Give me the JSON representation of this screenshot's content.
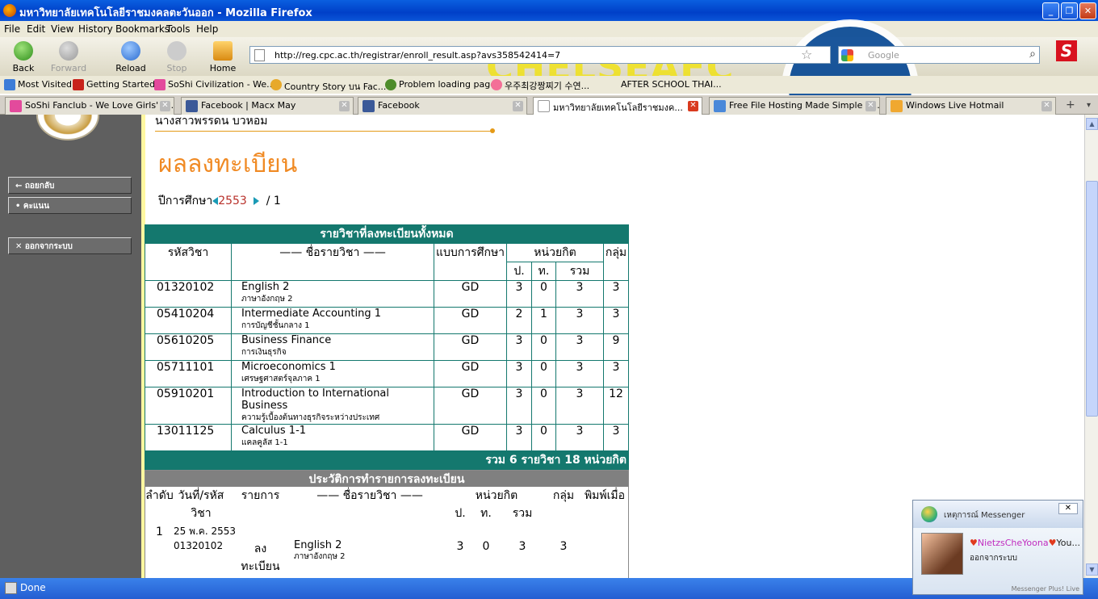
{
  "window": {
    "title": "มหาวิทยาลัยเทคโนโลยีราชมงคลตะวันออก - Mozilla Firefox"
  },
  "menu": [
    "File",
    "Edit",
    "View",
    "History",
    "Bookmarks",
    "Tools",
    "Help"
  ],
  "nav": {
    "back": "Back",
    "forward": "Forward",
    "reload": "Reload",
    "stop": "Stop",
    "home": "Home"
  },
  "url": "http://reg.cpc.ac.th/registrar/enroll_result.asp?avs358542414=7",
  "search": {
    "placeholder": "Google"
  },
  "background_overlay": "CHELSEAFC",
  "bookmarks": [
    "Most Visited",
    "Getting Started",
    "SoShi Civilization - We...",
    "Country Story บน Fac...",
    "Problem loading page",
    "우주최강짱찌기 수연...",
    "AFTER SCHOOL THAI..."
  ],
  "tabs": [
    {
      "label": "SoShi Fanclub - We Love Girls' G...",
      "active": false
    },
    {
      "label": "Facebook | Macx May",
      "active": false
    },
    {
      "label": "Facebook",
      "active": false
    },
    {
      "label": "มหาวิทยาลัยเทคโนโลยีราชมงค...",
      "active": true
    },
    {
      "label": "Free File Hosting Made Simple - ...",
      "active": false
    },
    {
      "label": "Windows Live Hotmail",
      "active": false
    }
  ],
  "sidebar": {
    "buttons": [
      "ถอยกลับ",
      "คะแนน",
      "ออกจากระบบ"
    ]
  },
  "page": {
    "student_name": "นางสาวพรรดน บวหอม",
    "heading": "ผลลงทะเบียน",
    "year_label": "ปีการศึกษา",
    "year": "2553",
    "separator": "/",
    "term": "1"
  },
  "table1": {
    "title": "รายวิชาที่ลงทะเบียนทั้งหมด",
    "headers": {
      "code": "รหัสวิชา",
      "name": "ชื่อรายวิชา",
      "type": "แบบการศึกษา",
      "credit": "หน่วยกิต",
      "lecture": "ป.",
      "lab": "ท.",
      "total": "รวม",
      "group": "กลุ่ม"
    },
    "name_dashes": "——",
    "rows": [
      {
        "code": "01320102",
        "en": "English 2",
        "th": "ภาษาอังกฤษ 2",
        "type": "GD",
        "p": "3",
        "t": "0",
        "sum": "3",
        "group": "3"
      },
      {
        "code": "05410204",
        "en": "Intermediate Accounting 1",
        "th": "การบัญชีชั้นกลาง 1",
        "type": "GD",
        "p": "2",
        "t": "1",
        "sum": "3",
        "group": "3"
      },
      {
        "code": "05610205",
        "en": "Business Finance",
        "th": "การเงินธุรกิจ",
        "type": "GD",
        "p": "3",
        "t": "0",
        "sum": "3",
        "group": "9"
      },
      {
        "code": "05711101",
        "en": "Microeconomics 1",
        "th": "เศรษฐศาสตร์จุลภาค 1",
        "type": "GD",
        "p": "3",
        "t": "0",
        "sum": "3",
        "group": "3"
      },
      {
        "code": "05910201",
        "en": "Introduction to International Business",
        "th": "ความรู้เบื้องต้นทางธุรกิจระหว่างประเทศ",
        "type": "GD",
        "p": "3",
        "t": "0",
        "sum": "3",
        "group": "12"
      },
      {
        "code": "13011125",
        "en": "Calculus 1-1",
        "th": "แคลคูลัส 1-1",
        "type": "GD",
        "p": "3",
        "t": "0",
        "sum": "3",
        "group": "3"
      }
    ],
    "footer": "รวม   6   รายวิชา   18   หน่วยกิต"
  },
  "table2": {
    "title": "ประวัติการทำรายการลงทะเบียน",
    "headers": {
      "seq": "ลำดับ",
      "date": "วันที่/รหัสวิชา",
      "action": "รายการ",
      "name": "ชื่อรายวิชา",
      "credit": "หน่วยกิต",
      "lecture": "ป.",
      "lab": "ท.",
      "total": "รวม",
      "group": "กลุ่ม",
      "print": "พิมพ์เมื่อ"
    },
    "name_dashes": "——",
    "entry": {
      "seq": "1",
      "date": "25 พ.ค. 2553",
      "code": "01320102",
      "action": "ลงทะเบียน",
      "en": "English 2",
      "th": "ภาษาอังกฤษ 2",
      "p": "3",
      "t": "0",
      "sum": "3",
      "group": "3"
    }
  },
  "status": "Done",
  "messenger": {
    "title": "เหตุการณ์ Messenger",
    "close": "✕",
    "name": "NietzsCheYoona",
    "suffix": "You...",
    "status": "ออกจากระบบ",
    "footer": "Messenger Plus! Live"
  }
}
